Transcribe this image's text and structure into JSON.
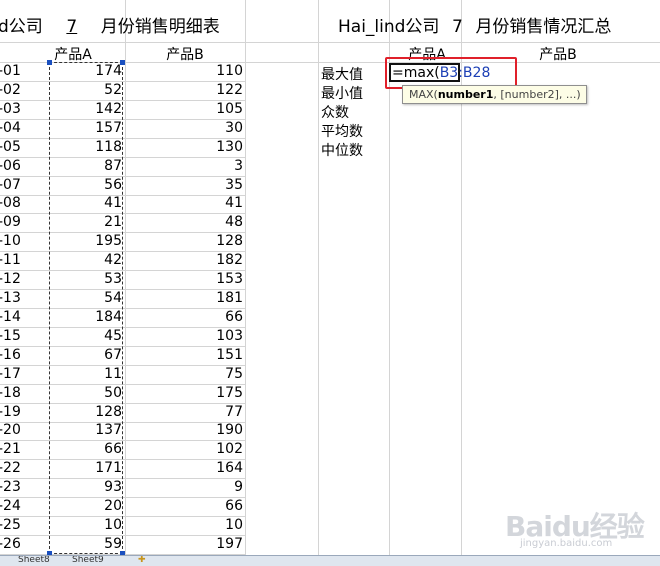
{
  "titles": {
    "left_prefix": "d公司",
    "left_month": "7",
    "left_suffix": "月份销售明细表",
    "right_company": "Hai_lind公司",
    "right_month": "7",
    "right_suffix": "月份销售情况汇总"
  },
  "left_table": {
    "headers": [
      "产品A",
      "产品B"
    ],
    "rows": [
      {
        "label": "-01",
        "a": "174",
        "b": "110"
      },
      {
        "label": "-02",
        "a": "52",
        "b": "122"
      },
      {
        "label": "-03",
        "a": "142",
        "b": "105"
      },
      {
        "label": "-04",
        "a": "157",
        "b": "30"
      },
      {
        "label": "-05",
        "a": "118",
        "b": "130"
      },
      {
        "label": "-06",
        "a": "87",
        "b": "3"
      },
      {
        "label": "-07",
        "a": "56",
        "b": "35"
      },
      {
        "label": "-08",
        "a": "41",
        "b": "41"
      },
      {
        "label": "-09",
        "a": "21",
        "b": "48"
      },
      {
        "label": "-10",
        "a": "195",
        "b": "128"
      },
      {
        "label": "-11",
        "a": "42",
        "b": "182"
      },
      {
        "label": "-12",
        "a": "53",
        "b": "153"
      },
      {
        "label": "-13",
        "a": "54",
        "b": "181"
      },
      {
        "label": "-14",
        "a": "184",
        "b": "66"
      },
      {
        "label": "-15",
        "a": "45",
        "b": "103"
      },
      {
        "label": "-16",
        "a": "67",
        "b": "151"
      },
      {
        "label": "-17",
        "a": "11",
        "b": "75"
      },
      {
        "label": "-18",
        "a": "50",
        "b": "175"
      },
      {
        "label": "-19",
        "a": "128",
        "b": "77"
      },
      {
        "label": "-20",
        "a": "137",
        "b": "190"
      },
      {
        "label": "-21",
        "a": "66",
        "b": "102"
      },
      {
        "label": "-22",
        "a": "171",
        "b": "164"
      },
      {
        "label": "-23",
        "a": "93",
        "b": "9"
      },
      {
        "label": "-24",
        "a": "20",
        "b": "66"
      },
      {
        "label": "-25",
        "a": "10",
        "b": "10"
      },
      {
        "label": "-26",
        "a": "59",
        "b": "197"
      }
    ]
  },
  "summary": {
    "headers": [
      "产品A",
      "产品B"
    ],
    "stats": [
      "最大值",
      "最小值",
      "众数",
      "平均数",
      "中位数"
    ],
    "formula_prefix": "=max(",
    "formula_ref": "B3:B28",
    "tooltip_func": "MAX(",
    "tooltip_arg1": "number1",
    "tooltip_rest": ", [number2], ...)"
  },
  "sheet_tabs": [
    "Sheet8",
    "Sheet9"
  ],
  "watermark": {
    "text": "Baidu经验",
    "sub": "jingyan.baidu.com"
  },
  "colors": {
    "highlight": "#e0202a",
    "reference": "#1c3fb5",
    "tooltip_bg": "#fdfde6"
  }
}
